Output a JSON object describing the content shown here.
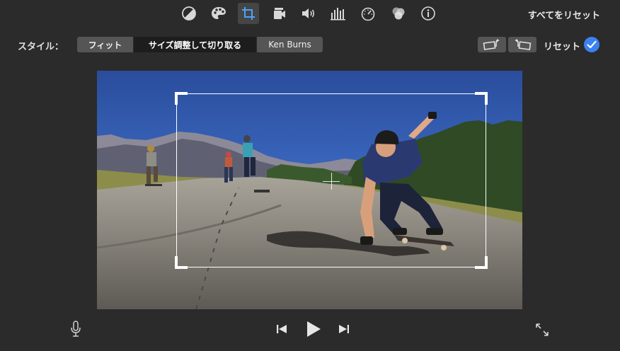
{
  "toolbar": {
    "tools": [
      {
        "name": "color-balance-icon",
        "active": false
      },
      {
        "name": "color-palette-icon",
        "active": false
      },
      {
        "name": "crop-icon",
        "active": true
      },
      {
        "name": "stabilization-icon",
        "active": false
      },
      {
        "name": "volume-icon",
        "active": false
      },
      {
        "name": "equalizer-icon",
        "active": false
      },
      {
        "name": "speed-icon",
        "active": false
      },
      {
        "name": "clip-filter-icon",
        "active": false
      },
      {
        "name": "info-icon",
        "active": false
      }
    ],
    "reset_all_label": "すべてをリセット"
  },
  "style": {
    "label": "スタイル：",
    "options": [
      "フィット",
      "サイズ調整して切り取る",
      "Ken Burns"
    ],
    "selected": "サイズ調整して切り取る"
  },
  "rotate": {
    "left_icon": "rotate-left-icon",
    "right_icon": "rotate-right-icon"
  },
  "reset_label": "リセット",
  "apply_icon": "checkmark-icon",
  "playback": {
    "mic_icon": "microphone-icon",
    "prev_icon": "skip-back-icon",
    "play_icon": "play-icon",
    "next_icon": "skip-forward-icon",
    "fullscreen_icon": "fullscreen-icon"
  },
  "colors": {
    "background": "#2b2b2b",
    "segment": "#555555",
    "segment_selected": "#1d1d1d",
    "accent_blue": "#3b82f0"
  }
}
